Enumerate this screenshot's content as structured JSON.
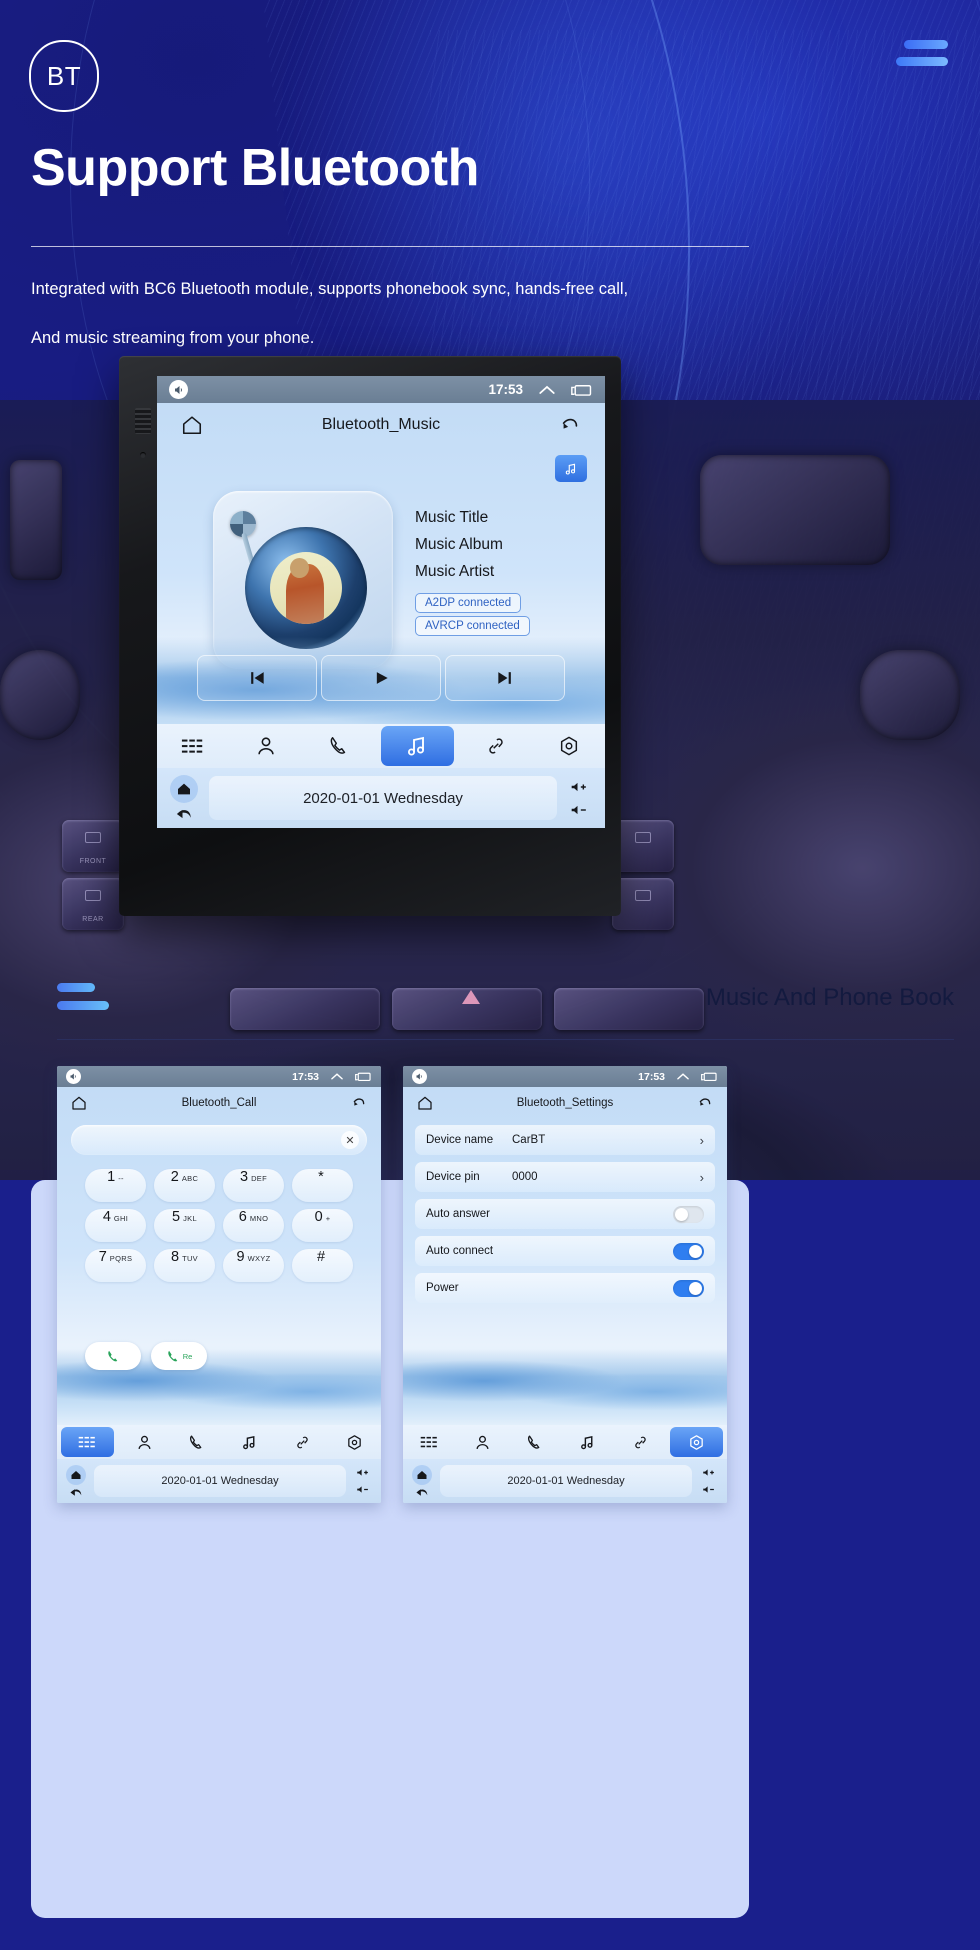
{
  "hero": {
    "badge": "BT",
    "title": "Support Bluetooth",
    "subtitle_line1": "Integrated with BC6 Bluetooth module, supports phonebook sync, hands-free call,",
    "subtitle_line2": "And music streaming from your phone.",
    "accent_color": "#4b7bf0",
    "background_color": "#1a1f8c"
  },
  "main_screen": {
    "status": {
      "time": "17:53",
      "volume_icon": "volume-icon",
      "expand_icon": "chevron-up-icon",
      "recents_icon": "recents-icon"
    },
    "title": "Bluetooth_Music",
    "home_icon": "home-icon",
    "back_icon": "back-arrow-icon",
    "bt_chip_icon": "music-note-icon",
    "metadata": {
      "title": "Music Title",
      "album": "Music Album",
      "artist": "Music Artist",
      "a2dp_status": "A2DP  connected",
      "avrcp_status": "AVRCP connected"
    },
    "transport": {
      "prev": "previous-track-icon",
      "play": "play-icon",
      "next": "next-track-icon"
    },
    "nav": [
      {
        "name": "apps",
        "icon": "list-icon",
        "active": false
      },
      {
        "name": "contacts",
        "icon": "person-icon",
        "active": false
      },
      {
        "name": "phone",
        "icon": "phone-icon",
        "active": false
      },
      {
        "name": "music",
        "icon": "music-note-icon",
        "active": true
      },
      {
        "name": "paired",
        "icon": "link-icon",
        "active": false
      },
      {
        "name": "settings",
        "icon": "gear-icon",
        "active": false
      }
    ],
    "dock": {
      "home_icon": "home-filled-icon",
      "back_icon": "back-arrow-filled-icon",
      "date": "2020-01-01 Wednesday",
      "vol_up_icon": "volume-up-icon",
      "vol_down_icon": "volume-down-icon"
    }
  },
  "bottom_card": {
    "title": "Music And Phone Book",
    "bars_color": "#4b7bf0"
  },
  "call_screen": {
    "status": {
      "time": "17:53"
    },
    "title": "Bluetooth_Call",
    "input_value": "",
    "clear_icon": "close-icon",
    "keys": [
      {
        "num": "1",
        "sub": "--"
      },
      {
        "num": "2",
        "sub": "ABC"
      },
      {
        "num": "3",
        "sub": "DEF"
      },
      {
        "num": "*",
        "sub": ""
      },
      {
        "num": "4",
        "sub": "GHI"
      },
      {
        "num": "5",
        "sub": "JKL"
      },
      {
        "num": "6",
        "sub": "MNO"
      },
      {
        "num": "0",
        "sub": "+"
      },
      {
        "num": "7",
        "sub": "PQRS"
      },
      {
        "num": "8",
        "sub": "TUV"
      },
      {
        "num": "9",
        "sub": "WXYZ"
      },
      {
        "num": "#",
        "sub": ""
      }
    ],
    "call_button_icon": "phone-call-icon",
    "redial_button_icon": "phone-redial-icon",
    "redial_label": "Re",
    "nav_active": "apps",
    "dock_date": "2020-01-01 Wednesday"
  },
  "settings_screen": {
    "status": {
      "time": "17:53"
    },
    "title": "Bluetooth_Settings",
    "rows": [
      {
        "label": "Device name",
        "value": "CarBT",
        "type": "chevron"
      },
      {
        "label": "Device pin",
        "value": "0000",
        "type": "chevron"
      },
      {
        "label": "Auto answer",
        "value": "",
        "type": "toggle",
        "on": false
      },
      {
        "label": "Auto connect",
        "value": "",
        "type": "toggle",
        "on": true
      },
      {
        "label": "Power",
        "value": "",
        "type": "toggle",
        "on": true
      }
    ],
    "nav_active": "settings",
    "dock_date": "2020-01-01 Wednesday"
  }
}
